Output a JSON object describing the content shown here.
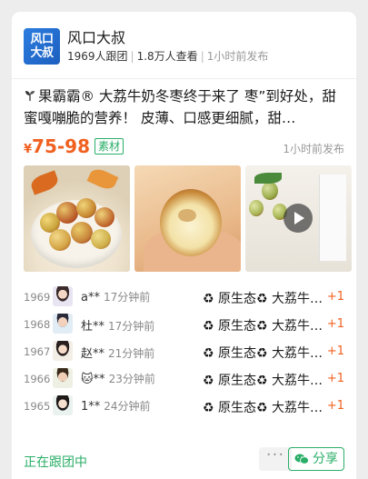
{
  "publisher": {
    "name": "风口大叔",
    "logo_text": [
      "风口",
      "大叔"
    ],
    "followers": "1969人跟团",
    "views": "1.8万人查看",
    "published": "1小时前发布"
  },
  "post": {
    "description": "果霸霸® 大荔牛奶冬枣终于来了 枣”到好处，甜蜜嘎嘣脆的营养！ 皮薄、口感更细腻，甜…",
    "price_symbol": "¥",
    "price": "75-98",
    "badge": "素材",
    "published": "1小时前发布"
  },
  "images": [
    {
      "name": "jujube-bowl-photo",
      "type": "photo"
    },
    {
      "name": "jujube-bitten-photo",
      "type": "photo"
    },
    {
      "name": "jujube-video-thumbnail",
      "type": "video"
    }
  ],
  "orders": [
    {
      "index": "1969",
      "name": "a**",
      "time": "17分钟前",
      "product": "♻ 原生态♻ 大荔牛奶冬枣",
      "qty": "+1",
      "avatar": "girl"
    },
    {
      "index": "1968",
      "name": "杜**",
      "time": "17分钟前",
      "product": "♻ 原生态♻ 大荔牛奶冬枣",
      "qty": "+1",
      "avatar": "man"
    },
    {
      "index": "1967",
      "name": "赵**",
      "time": "21分钟前",
      "product": "♻ 原生态♻ 大荔牛奶冬枣",
      "qty": "+1",
      "avatar": "girl2"
    },
    {
      "index": "1966",
      "name": "🐱**",
      "time": "23分钟前",
      "product": "♻ 原生态♻ 大荔牛奶冬枣",
      "qty": "+1",
      "avatar": "man2"
    },
    {
      "index": "1965",
      "name": "1**",
      "time": "24分钟前",
      "product": "♻ 原生态♻ 大荔牛奶冬枣",
      "qty": "+1",
      "avatar": "girl3"
    }
  ],
  "footer": {
    "following": "正在跟团中",
    "more": "···",
    "share": "分享"
  },
  "colors": {
    "accent_green": "#2aae67",
    "price_orange": "#f06020",
    "logo_blue": "#1c5fbf"
  }
}
